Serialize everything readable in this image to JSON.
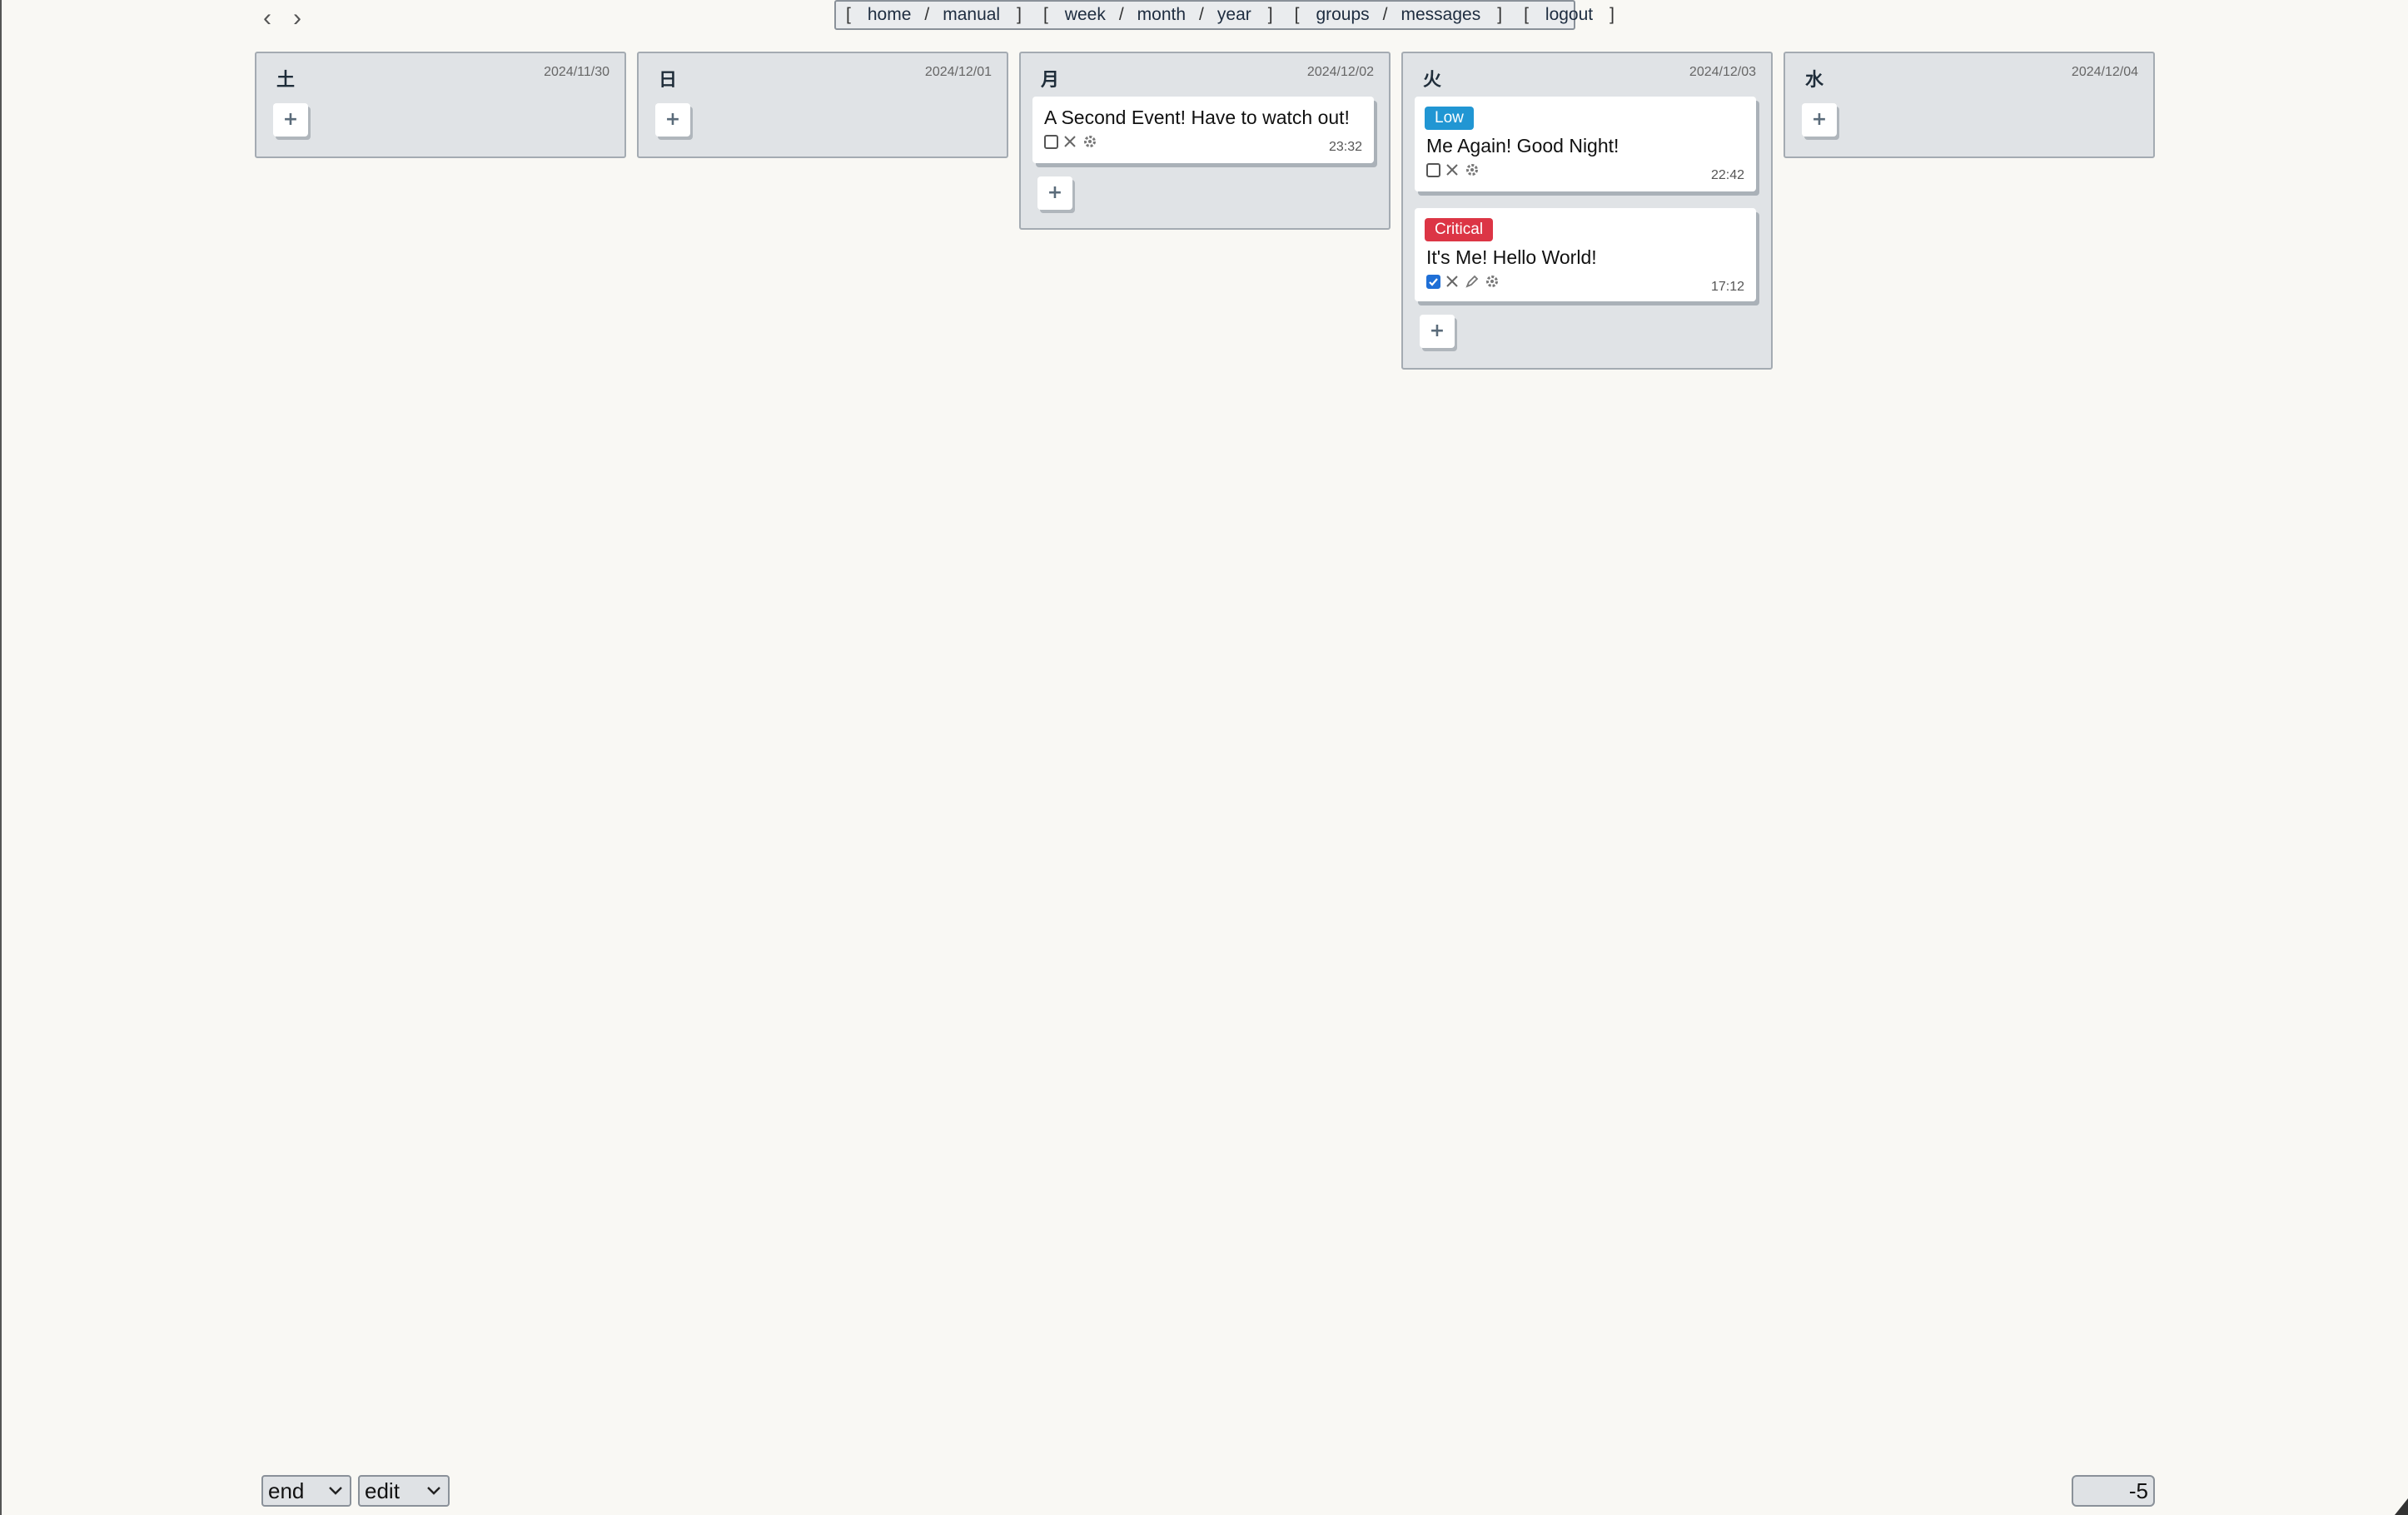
{
  "nav": {
    "prev_glyph": "‹",
    "next_glyph": "›",
    "links": {
      "home": "home",
      "manual": "manual",
      "week": "week",
      "month": "month",
      "year": "year",
      "groups": "groups",
      "messages": "messages",
      "logout": "logout"
    },
    "bracket_open": "[",
    "bracket_close": "]",
    "separator": "/"
  },
  "add_label": "+",
  "days": [
    {
      "day": "土",
      "date": "2024/11/30"
    },
    {
      "day": "日",
      "date": "2024/12/01"
    },
    {
      "day": "月",
      "date": "2024/12/02",
      "events": [
        {
          "title": "A Second Event! Have to watch out!",
          "time": "23:32",
          "checked": false
        }
      ]
    },
    {
      "day": "火",
      "date": "2024/12/03",
      "events": [
        {
          "badge": "Low",
          "badge_color": "#2196d3",
          "title": "Me Again! Good Night!",
          "time": "22:42",
          "checked": false
        },
        {
          "badge": "Critical",
          "badge_color": "#dc3545",
          "title": "It's Me! Hello World!",
          "time": "17:12",
          "checked": true
        }
      ]
    },
    {
      "day": "水",
      "date": "2024/12/04"
    }
  ],
  "footer": {
    "select_end": "end",
    "select_edit": "edit",
    "offset_value": "-5"
  }
}
